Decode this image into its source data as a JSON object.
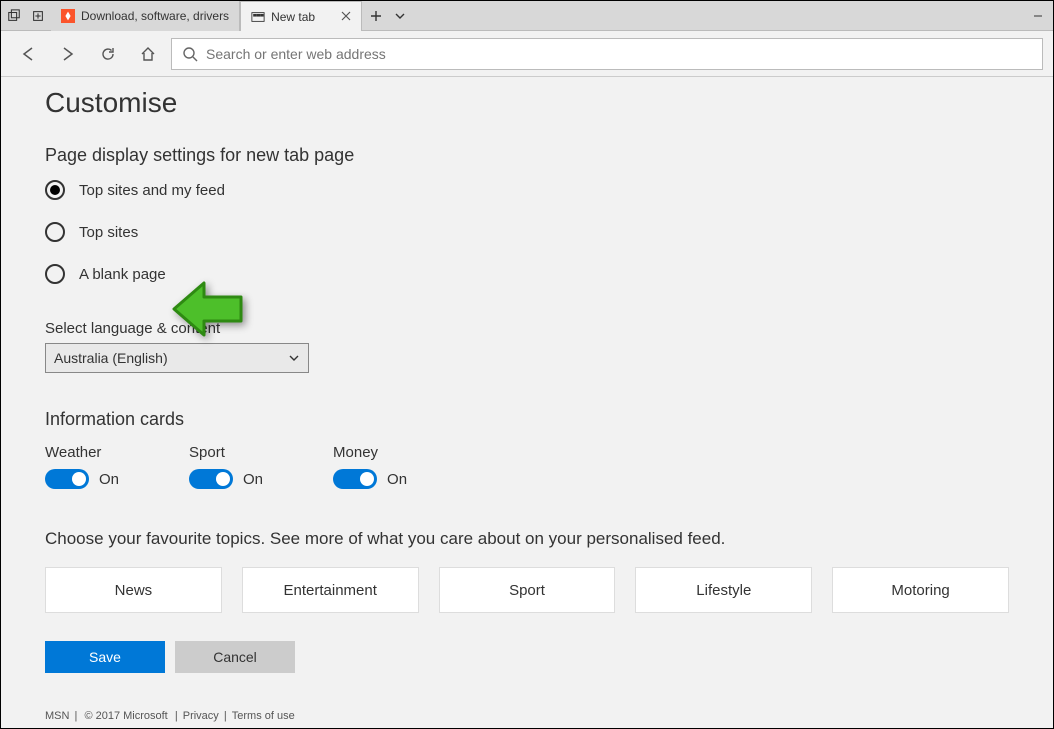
{
  "titlebar": {
    "tabs": [
      {
        "label": "Download, software, drivers"
      },
      {
        "label": "New tab"
      }
    ]
  },
  "toolbar": {
    "address_placeholder": "Search or enter web address"
  },
  "page": {
    "title": "Customise",
    "display_section": "Page display settings for new tab page",
    "radios": [
      "Top sites and my feed",
      "Top sites",
      "A blank page"
    ],
    "language_label": "Select language & content",
    "language_value": "Australia (English)",
    "info_cards_label": "Information cards",
    "cards": [
      {
        "title": "Weather",
        "state": "On"
      },
      {
        "title": "Sport",
        "state": "On"
      },
      {
        "title": "Money",
        "state": "On"
      }
    ],
    "topics_text": "Choose your favourite topics. See more of what you care about on your personalised feed.",
    "topics": [
      "News",
      "Entertainment",
      "Sport",
      "Lifestyle",
      "Motoring"
    ],
    "save": "Save",
    "cancel": "Cancel"
  },
  "footer": {
    "msn": "MSN",
    "copyright": "© 2017 Microsoft",
    "privacy": "Privacy",
    "terms": "Terms of use"
  }
}
